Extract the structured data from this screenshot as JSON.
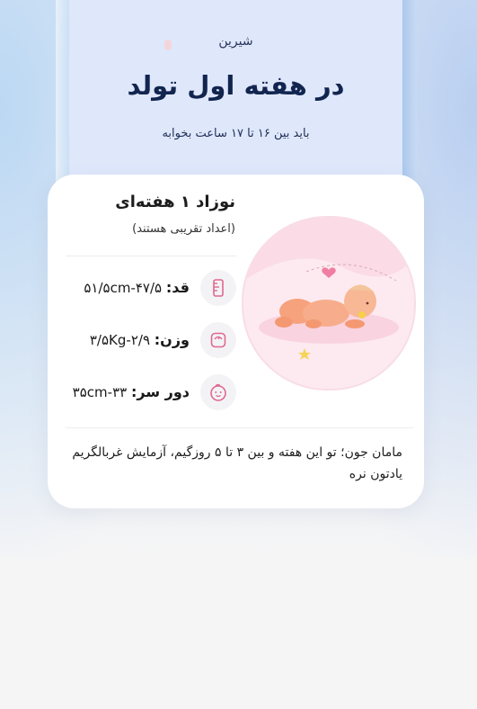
{
  "hero": {
    "tag": "شیرین",
    "title": "در هفته اول تولد",
    "subtitle": "باید بین ۱۶ تا ۱۷ ساعت بخوابه"
  },
  "card": {
    "title": "نوزاد ۱ هفته‌ای",
    "note": "(اعداد تقریبی هستند)",
    "stats": [
      {
        "label": "قد:",
        "value": "۴۷/۵-۵۱/۵cm",
        "icon": "ruler-icon"
      },
      {
        "label": "وزن:",
        "value": "۲/۹-۳/۵Kg",
        "icon": "scale-icon"
      },
      {
        "label": "دور سر:",
        "value": "۳۳-۳۵cm",
        "icon": "baby-face-icon"
      }
    ],
    "footer": "مامان جون؛ تو این هفته و بین ۳ تا ۵ روزگیم، آزمایش غربالگریم یادتون نره"
  },
  "colors": {
    "hero_bg": "#dfe7fb",
    "title": "#11254f",
    "card_bg": "#ffffff",
    "illustration_bg": "#fdeaf0"
  }
}
